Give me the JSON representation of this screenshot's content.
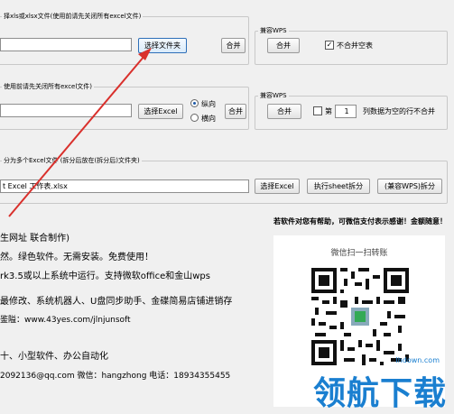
{
  "group1": {
    "label": "择xls或xlsx文件(使用前请先关闭所有excel文件)",
    "select_button": "选择文件夹",
    "merge_button": "合并"
  },
  "group1_compat": {
    "label": "兼容WPS",
    "merge_button": "合并",
    "checkbox_label": "不合并空表",
    "checkbox_checked": true
  },
  "group2": {
    "label": "使用前请先关闭所有excel文件)",
    "select_button": "选择Excel",
    "radio_portrait": "纵向",
    "radio_landscape": "横向",
    "merge_button": "合并"
  },
  "group2_compat": {
    "label": "兼容WPS",
    "merge_button": "合并",
    "checkbox_prefix": "第",
    "row_value": "1",
    "checkbox_suffix": "列数据为空的行不合并"
  },
  "group3": {
    "label": "分为多个Excel文件 (拆分后放在(拆分后)文件夹)",
    "file_value": "t Excel 工作表.xlsx",
    "select_button": "选择Excel",
    "split_button": "执行sheet拆分",
    "wps_split_button": "(兼容WPS)拆分"
  },
  "donation_text": "若软件对您有帮助，可微信支付表示感谢！金额随意！",
  "info_lines": [
    "生网址 联合制作)",
    "然。绿色软件。无需安装。免费使用！",
    "rk3.5或以上系统中运行。支持微软office和金山wps",
    "最修改、系统机器人、U盘同步助手、金碟简易店铺进销存",
    "鉴隘：www.43yes.com/jlnjunsoft",
    "十、小型软件、办公自动化",
    "2092136@qq.com    微信：hangzhong   电话：18934355455"
  ],
  "qr": {
    "caption": "微信扫一扫转账",
    "watermark_small": "lhdown.com",
    "watermark_big": "领航下载"
  },
  "colors": {
    "arrow": "#d9302c",
    "watermark": "#1a7fd0",
    "link_blue": "#1e5aa8"
  }
}
